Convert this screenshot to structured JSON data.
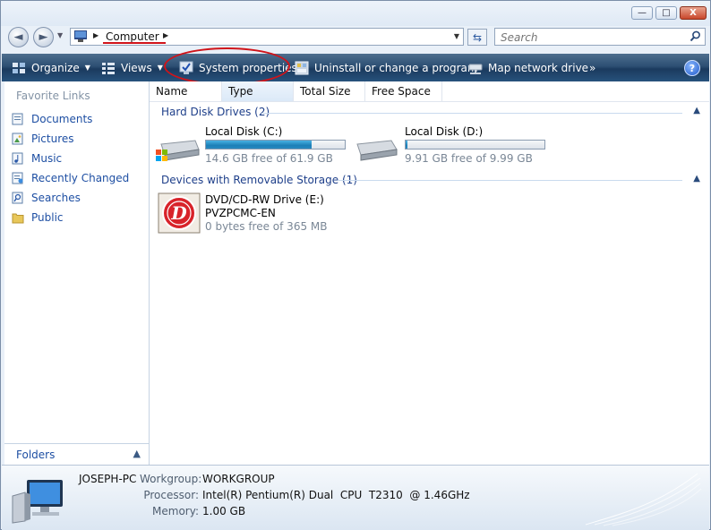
{
  "window": {
    "caption_buttons": {
      "minimize": "—",
      "maximize": "□",
      "close": "X"
    }
  },
  "navigation": {
    "back": "◄",
    "forward": "►",
    "breadcrumb": "Computer",
    "search_placeholder": "Search"
  },
  "toolbar": {
    "organize": "Organize",
    "views": "Views",
    "system_properties": "System properties",
    "uninstall": "Uninstall or change a program",
    "map_drive": "Map network drive",
    "more": "»",
    "help": "?"
  },
  "sidebar": {
    "header": "Favorite Links",
    "items": [
      {
        "label": "Documents",
        "icon": "documents-icon"
      },
      {
        "label": "Pictures",
        "icon": "pictures-icon"
      },
      {
        "label": "Music",
        "icon": "music-icon"
      },
      {
        "label": "Recently Changed",
        "icon": "recently-changed-icon"
      },
      {
        "label": "Searches",
        "icon": "searches-icon"
      },
      {
        "label": "Public",
        "icon": "public-folder-icon"
      }
    ],
    "folders_label": "Folders"
  },
  "columns": [
    "Name",
    "Type",
    "Total Size",
    "Free Space"
  ],
  "groups": {
    "hard_disks": {
      "title": "Hard Disk Drives (2)",
      "drives": [
        {
          "name": "Local Disk (C:)",
          "free_text": "14.6 GB free of 61.9 GB",
          "used_fraction": 0.764
        },
        {
          "name": "Local Disk (D:)",
          "free_text": "9.91 GB free of 9.99 GB",
          "used_fraction": 0.008
        }
      ]
    },
    "removable": {
      "title": "Devices with Removable Storage (1)",
      "device": {
        "name": "DVD/CD-RW Drive (E:)",
        "label": "PVZPCMC-EN",
        "free_text": "0 bytes free of 365 MB"
      }
    }
  },
  "details": {
    "computer_name": "JOSEPH-PC",
    "workgroup_label": "Workgroup:",
    "workgroup_value": "WORKGROUP",
    "processor_label": "Processor:",
    "processor_value": "Intel(R) Pentium(R) Dual  CPU  T2310  @ 1.46GHz",
    "memory_label": "Memory:",
    "memory_value": "1.00 GB"
  },
  "colors": {
    "toolbar": "#2d4f73",
    "link": "#1e4fa3",
    "annotation_red": "#d0141a",
    "bar_fill": "#1d7fb7"
  }
}
